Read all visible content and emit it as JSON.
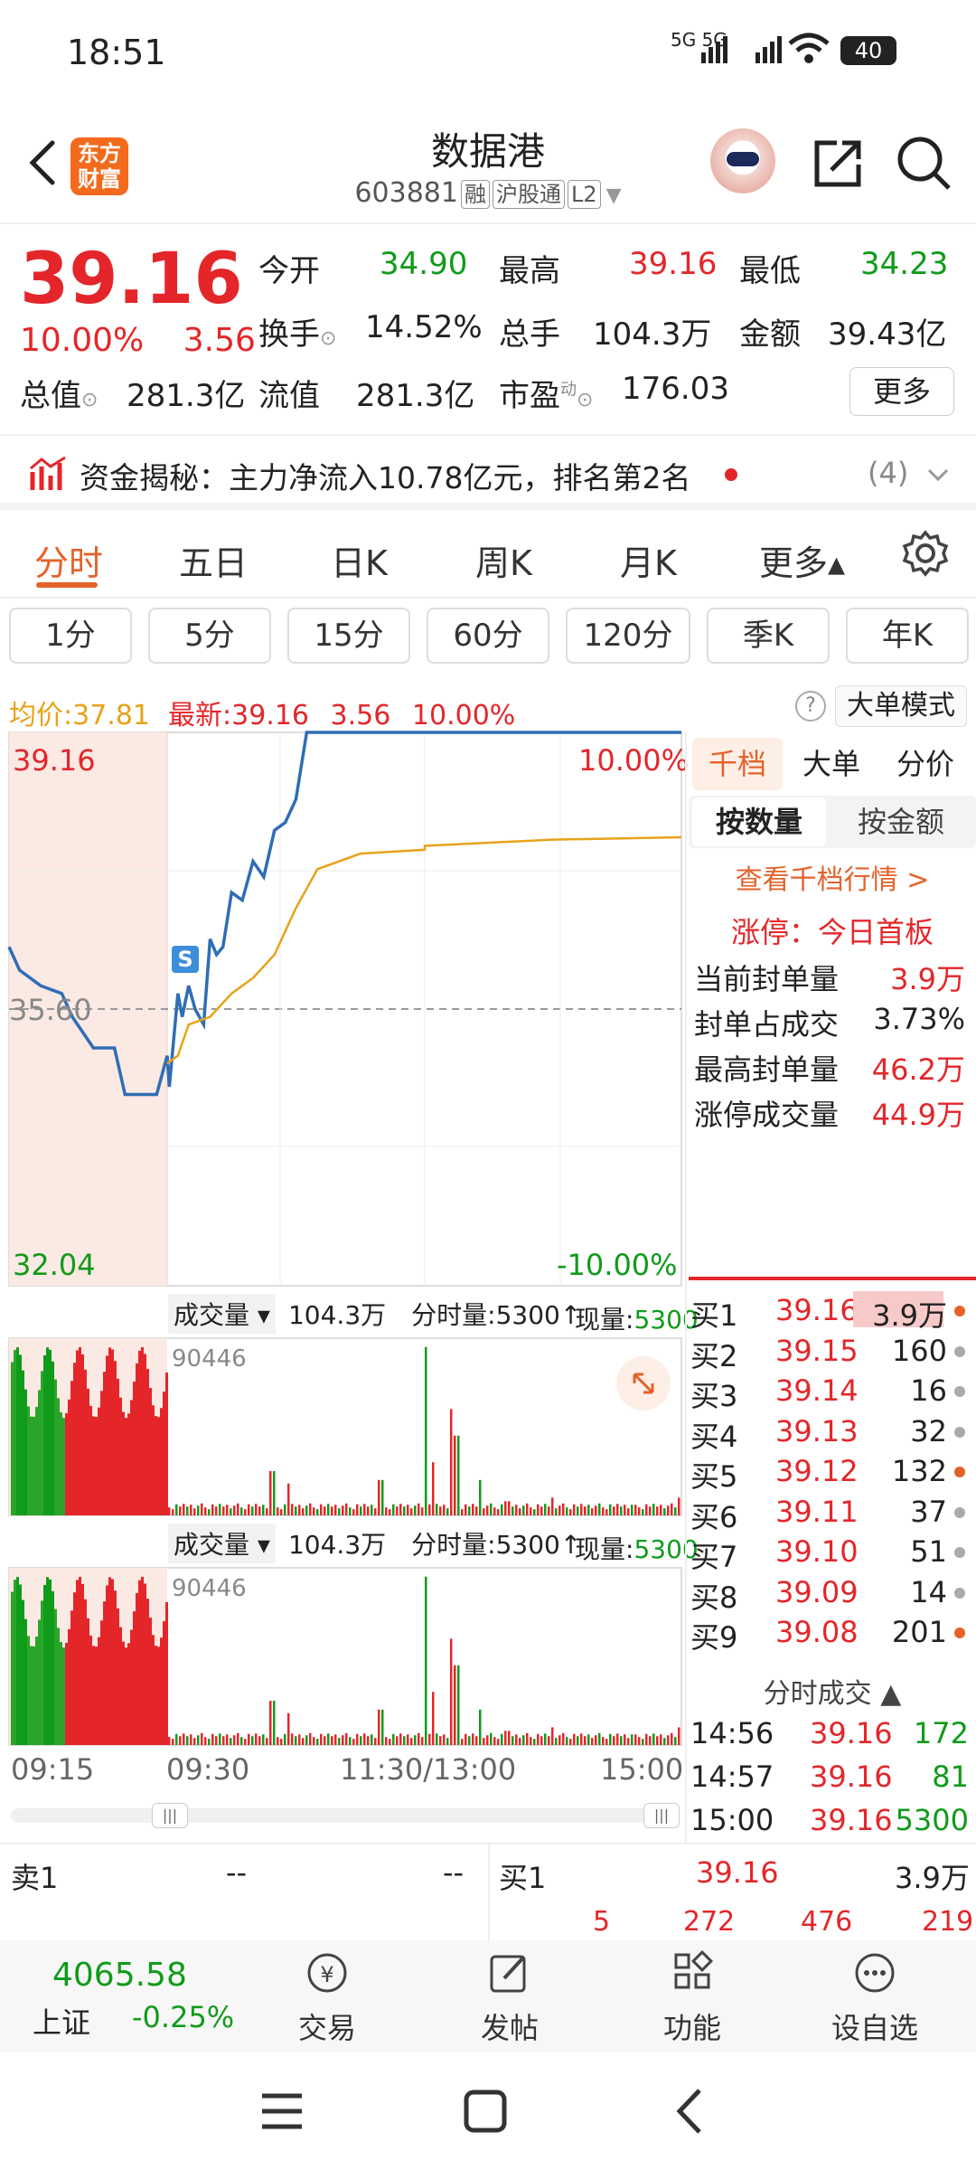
{
  "status_bar": {
    "time": "18:51",
    "indicators": "5G 5G",
    "battery": "40"
  },
  "header": {
    "title": "数据港",
    "code": "603881",
    "tags": [
      "融",
      "沪股通",
      "L2"
    ],
    "logo_text_1": "东方",
    "logo_text_2": "财富"
  },
  "quote": {
    "price": "39.16",
    "change_pct": "10.00%",
    "change": "3.56",
    "fields": [
      {
        "label": "今开",
        "value": "34.90",
        "color": "green"
      },
      {
        "label": "最高",
        "value": "39.16",
        "color": "red"
      },
      {
        "label": "最低",
        "value": "34.23",
        "color": "green"
      },
      {
        "label": "换手",
        "value": "14.52%",
        "color": "dark"
      },
      {
        "label": "总手",
        "value": "104.3万",
        "color": "dark"
      },
      {
        "label": "金额",
        "value": "39.43亿",
        "color": "dark"
      },
      {
        "label": "总值",
        "value": "281.3亿",
        "color": "dark"
      },
      {
        "label": "流值",
        "value": "281.3亿",
        "color": "dark"
      },
      {
        "label": "市盈",
        "value": "176.03",
        "color": "dark"
      }
    ],
    "pe_superscript": "动",
    "more": "更多"
  },
  "fund_banner": {
    "text": "资金揭秘：主力净流入10.78亿元，排名第2名",
    "count": "(4)"
  },
  "period_tabs": [
    "分时",
    "五日",
    "日K",
    "周K",
    "月K",
    "更多▴"
  ],
  "active_tab": "分时",
  "intervals": [
    "1分",
    "5分",
    "15分",
    "60分",
    "120分",
    "季K",
    "年K"
  ],
  "avg_line": {
    "avg_label": "均价:",
    "avg_value": "37.81",
    "last_label": "最新:",
    "last_value": "39.16",
    "change": "3.56",
    "pct": "10.00%",
    "mode_button": "大单模式",
    "help": "?"
  },
  "chart": {
    "price_high_label": "39.16",
    "price_mid_label": "35.60",
    "price_low_label": "32.04",
    "pct_high_label": "10.00%",
    "pct_low_label": "-10.00%",
    "s_marker": "S",
    "volume_panels": [
      {
        "label": "成交量",
        "total": "104.3万",
        "period_label": "分时量:5300",
        "current_label": "现量:",
        "current_value": "5300",
        "max_label": "90446"
      },
      {
        "label": "成交量",
        "total": "104.3万",
        "period_label": "分时量:5300",
        "current_label": "现量:",
        "current_value": "5300",
        "max_label": "90446"
      }
    ],
    "time_axis": [
      "09:15",
      "09:30",
      "11:30/13:00",
      "15:00"
    ]
  },
  "chart_data": {
    "type": "line",
    "title": "",
    "ylim": [
      32.04,
      39.16
    ],
    "y_ref": 35.6,
    "series": [
      {
        "x": [
          "09:15",
          "09:16",
          "09:18",
          "09:20",
          "09:21",
          "09:23",
          "09:25",
          "09:26",
          "09:29",
          "09:30",
          "09:31",
          "09:33",
          "09:35",
          "09:37",
          "09:40",
          "09:43",
          "09:47",
          "09:50",
          "09:53",
          "09:56",
          "10:00",
          "10:05",
          "10:10",
          "10:15",
          "10:20",
          "10:25",
          "10:30",
          "10:35",
          "10:40",
          "10:45",
          "10:50",
          "10:55",
          "11:00",
          "11:05",
          "11:10",
          "11:15",
          "11:20",
          "11:30"
        ],
        "values": [
          36.4,
          36.1,
          35.9,
          35.8,
          35.5,
          35.1,
          35.1,
          34.5,
          34.5,
          35.0,
          34.6,
          35.2,
          35.8,
          35.5,
          35.9,
          35.6,
          35.4,
          36.5,
          36.3,
          36.4,
          37.1,
          37.0,
          37.5,
          37.3,
          37.9,
          38.0,
          38.3,
          39.16,
          39.16,
          39.16,
          39.16,
          39.16,
          39.16,
          39.16,
          39.16,
          39.16,
          39.16,
          39.16
        ]
      },
      {
        "x": [
          "09:30",
          "09:35",
          "09:40",
          "09:50",
          "10:00",
          "10:10",
          "10:20",
          "10:30",
          "10:40",
          "11:00",
          "11:30",
          "13:00",
          "14:00",
          "15:00"
        ],
        "values": [
          34.9,
          35.0,
          35.4,
          35.5,
          35.8,
          36.0,
          36.3,
          36.9,
          37.4,
          37.6,
          37.65,
          37.7,
          37.78,
          37.81
        ]
      }
    ]
  },
  "right_panel": {
    "tabs": [
      "千档",
      "大单",
      "分价"
    ],
    "seg": [
      "按数量",
      "按金额"
    ],
    "link": "查看千档行情 >",
    "limit_title": "涨停：今日首板",
    "limit_rows": [
      {
        "label": "当前封单量",
        "value": "3.9万",
        "red": true
      },
      {
        "label": "封单占成交",
        "value": "3.73%",
        "red": false
      },
      {
        "label": "最高封单量",
        "value": "46.2万",
        "red": true
      },
      {
        "label": "涨停成交量",
        "value": "44.9万",
        "red": true
      }
    ],
    "bids": [
      {
        "level": "买1",
        "price": "39.16",
        "vol": "3.9万",
        "dot": "#e4622a"
      },
      {
        "level": "买2",
        "price": "39.15",
        "vol": "160",
        "dot": "#aaaaaa"
      },
      {
        "level": "买3",
        "price": "39.14",
        "vol": "16",
        "dot": "#aaaaaa"
      },
      {
        "level": "买4",
        "price": "39.13",
        "vol": "32",
        "dot": "#aaaaaa"
      },
      {
        "level": "买5",
        "price": "39.12",
        "vol": "132",
        "dot": "#e4622a"
      },
      {
        "level": "买6",
        "price": "39.11",
        "vol": "37",
        "dot": "#aaaaaa"
      },
      {
        "level": "买7",
        "price": "39.10",
        "vol": "51",
        "dot": "#aaaaaa"
      },
      {
        "level": "买8",
        "price": "39.09",
        "vol": "14",
        "dot": "#aaaaaa"
      },
      {
        "level": "买9",
        "price": "39.08",
        "vol": "201",
        "dot": "#e4622a"
      }
    ],
    "ticks_title": "分时成交",
    "ticks": [
      {
        "time": "14:56",
        "price": "39.16",
        "vol": "172"
      },
      {
        "time": "14:57",
        "price": "39.16",
        "vol": "81"
      },
      {
        "time": "15:00",
        "price": "39.16",
        "vol": "5300"
      }
    ]
  },
  "order_bar": {
    "sell_label": "卖1",
    "sell_price": "--",
    "sell_vol": "--",
    "buy_label": "买1",
    "buy_price": "39.16",
    "buy_vol": "3.9万",
    "queue": [
      "5",
      "272",
      "476",
      "219"
    ]
  },
  "bottom_nav": {
    "index_value": "4065.58",
    "index_name": "上证",
    "index_change": "-0.25%",
    "items": [
      "交易",
      "发帖",
      "功能",
      "设自选"
    ]
  },
  "colors": {
    "up": "#e4262a",
    "down": "#109b1a",
    "accent": "#e4622a",
    "line": "#2f6db5",
    "avg": "#e8a21a"
  }
}
